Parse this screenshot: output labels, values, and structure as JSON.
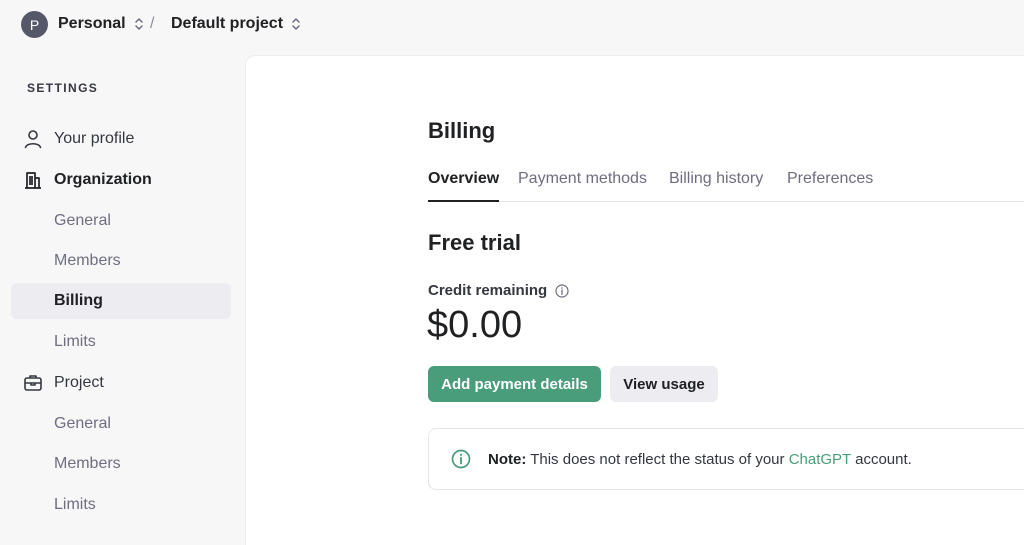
{
  "header": {
    "org_initial": "P",
    "org_name": "Personal",
    "separator": "/",
    "project_name": "Default project"
  },
  "sidebar": {
    "heading": "SETTINGS",
    "items": [
      {
        "label": "Your profile",
        "icon": "person-icon"
      },
      {
        "label": "Organization",
        "icon": "building-icon"
      },
      {
        "label": "General"
      },
      {
        "label": "Members"
      },
      {
        "label": "Billing",
        "active": true
      },
      {
        "label": "Limits"
      },
      {
        "label": "Project",
        "icon": "briefcase-icon"
      },
      {
        "label": "General"
      },
      {
        "label": "Members"
      },
      {
        "label": "Limits"
      }
    ]
  },
  "main": {
    "title": "Billing",
    "tabs": [
      {
        "label": "Overview",
        "active": true
      },
      {
        "label": "Payment methods"
      },
      {
        "label": "Billing history"
      },
      {
        "label": "Preferences"
      }
    ],
    "plan_title": "Free trial",
    "credit_label": "Credit remaining",
    "credit_value": "$0.00",
    "add_payment_label": "Add payment details",
    "view_usage_label": "View usage",
    "note": {
      "prefix": "Note:",
      "text": " This does not reflect the status of your ",
      "link": "ChatGPT",
      "suffix": " account."
    }
  },
  "colors": {
    "accent": "#4a9d7a",
    "active_bg": "#ececf1"
  }
}
